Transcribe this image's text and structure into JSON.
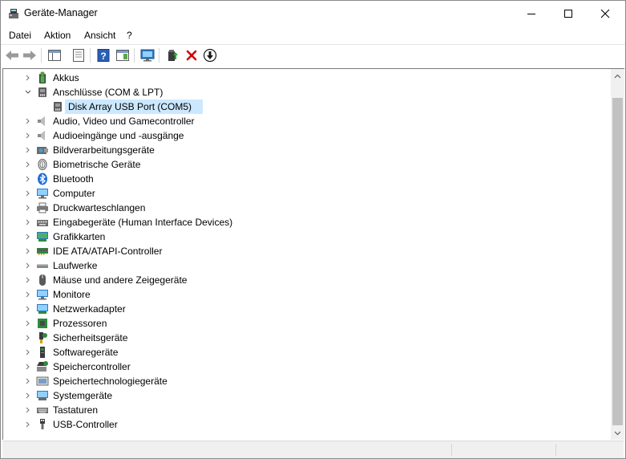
{
  "window": {
    "title": "Geräte-Manager"
  },
  "menu": [
    "Datei",
    "Aktion",
    "Ansicht",
    "?"
  ],
  "toolbar": [
    {
      "name": "back-button",
      "icon": "arrow-left-icon"
    },
    {
      "name": "forward-button",
      "icon": "arrow-right-icon"
    },
    {
      "name": "show-hide-console-tree-button",
      "icon": "console-tree-icon"
    },
    {
      "name": "properties-button",
      "icon": "properties-icon"
    },
    {
      "name": "help-button",
      "icon": "help-icon"
    },
    {
      "name": "action-pane-button",
      "icon": "action-pane-icon"
    },
    {
      "name": "scan-hardware-button",
      "icon": "monitor-scan-icon"
    },
    {
      "name": "update-driver-button",
      "icon": "update-driver-icon"
    },
    {
      "name": "uninstall-device-button",
      "icon": "red-x-icon"
    },
    {
      "name": "disable-device-button",
      "icon": "down-arrow-circle-icon"
    }
  ],
  "tree": [
    {
      "label": "Akkus",
      "icon": "battery-icon",
      "level": 0,
      "expanded": false
    },
    {
      "label": "Anschlüsse (COM & LPT)",
      "icon": "port-icon",
      "level": 0,
      "expanded": true
    },
    {
      "label": "Disk Array USB Port (COM5)",
      "icon": "port-icon",
      "level": 1,
      "selected": true
    },
    {
      "label": "Audio, Video und Gamecontroller",
      "icon": "speaker-icon",
      "level": 0
    },
    {
      "label": "Audioeingänge und -ausgänge",
      "icon": "speaker-icon",
      "level": 0
    },
    {
      "label": "Bildverarbeitungsgeräte",
      "icon": "camera-icon",
      "level": 0
    },
    {
      "label": "Biometrische Geräte",
      "icon": "fingerprint-icon",
      "level": 0
    },
    {
      "label": "Bluetooth",
      "icon": "bluetooth-icon",
      "level": 0
    },
    {
      "label": "Computer",
      "icon": "computer-icon",
      "level": 0
    },
    {
      "label": "Druckwarteschlangen",
      "icon": "printer-icon",
      "level": 0
    },
    {
      "label": "Eingabegeräte (Human Interface Devices)",
      "icon": "keyboard-hid-icon",
      "level": 0
    },
    {
      "label": "Grafikkarten",
      "icon": "display-adapter-icon",
      "level": 0
    },
    {
      "label": "IDE ATA/ATAPI-Controller",
      "icon": "ide-controller-icon",
      "level": 0
    },
    {
      "label": "Laufwerke",
      "icon": "drive-icon",
      "level": 0
    },
    {
      "label": "Mäuse und andere Zeigegeräte",
      "icon": "mouse-icon",
      "level": 0
    },
    {
      "label": "Monitore",
      "icon": "monitor-icon",
      "level": 0
    },
    {
      "label": "Netzwerkadapter",
      "icon": "network-adapter-icon",
      "level": 0
    },
    {
      "label": "Prozessoren",
      "icon": "processor-icon",
      "level": 0
    },
    {
      "label": "Sicherheitsgeräte",
      "icon": "security-device-icon",
      "level": 0
    },
    {
      "label": "Softwaregeräte",
      "icon": "software-device-icon",
      "level": 0
    },
    {
      "label": "Speichercontroller",
      "icon": "storage-controller-icon",
      "level": 0
    },
    {
      "label": "Speichertechnologiegeräte",
      "icon": "storage-technology-icon",
      "level": 0
    },
    {
      "label": "Systemgeräte",
      "icon": "system-device-icon",
      "level": 0
    },
    {
      "label": "Tastaturen",
      "icon": "keyboard-icon",
      "level": 0
    },
    {
      "label": "USB-Controller",
      "icon": "usb-icon",
      "level": 0
    }
  ],
  "colors": {
    "selection": "#cce8ff",
    "accent": "#0078d7",
    "danger": "#d40000"
  }
}
